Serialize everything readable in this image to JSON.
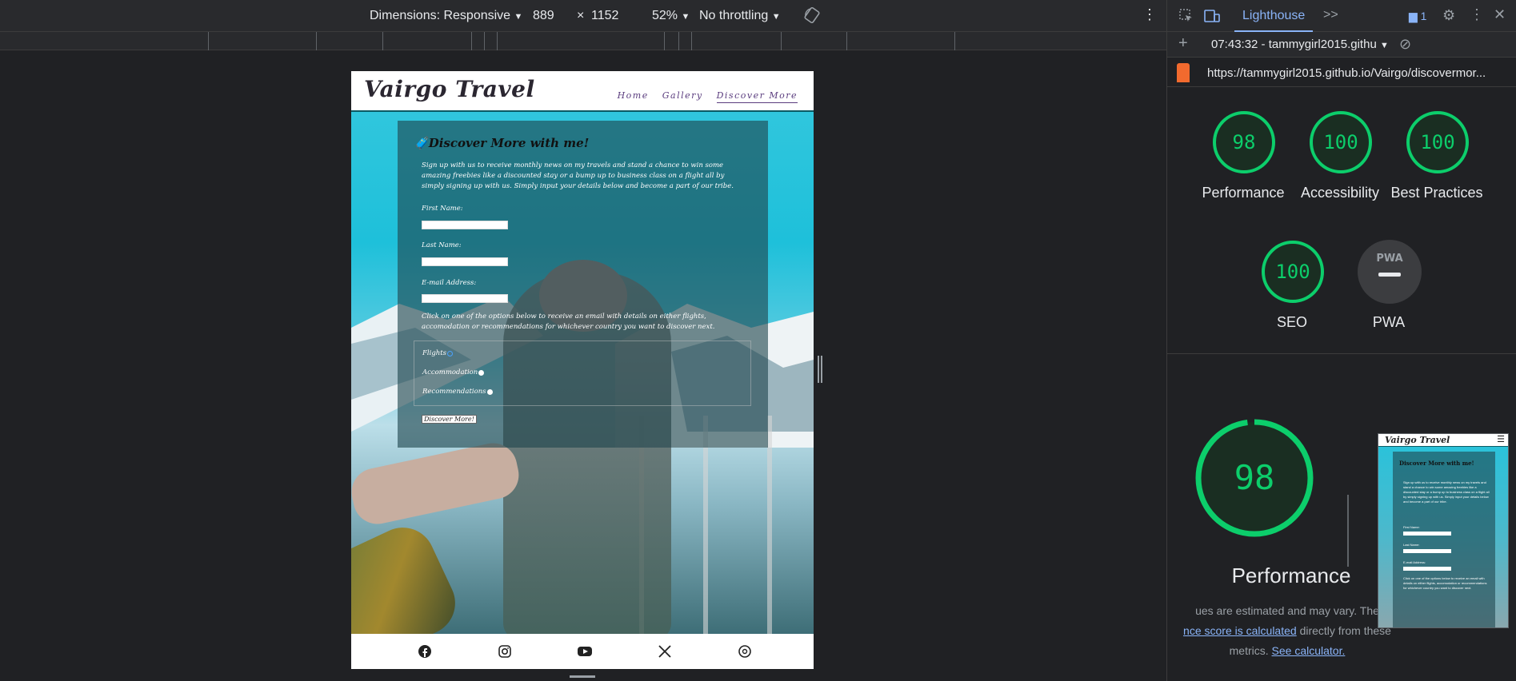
{
  "toolbar": {
    "dimensions_label": "Dimensions: Responsive",
    "width": "889",
    "times": "×",
    "height": "1152",
    "zoom": "52%",
    "throttling": "No throttling"
  },
  "panel": {
    "tab_label": "Lighthouse",
    "more_tabs": ">>",
    "issues_count": "1",
    "report_label": "07:43:32 - tammygirl2015.githu",
    "url": "https://tammygirl2015.github.io/Vairgo/discovermor...",
    "scores": [
      {
        "label": "Performance",
        "value": "98",
        "color": "#0cce6b"
      },
      {
        "label": "Accessibility",
        "value": "100",
        "color": "#0cce6b"
      },
      {
        "label": "Best Practices",
        "value": "100",
        "color": "#0cce6b"
      },
      {
        "label": "SEO",
        "value": "100",
        "color": "#0cce6b"
      },
      {
        "label": "PWA",
        "value": "PWA",
        "color": "#9aa0a6"
      }
    ],
    "big_score": "98",
    "big_label": "Performance",
    "note_line1": "ues are estimated and may vary. The",
    "note_link1": "nce score is calculated",
    "note_line2": " directly from these",
    "note_line3": "metrics.",
    "note_link2": "See calculator."
  },
  "site": {
    "logo": "Vairgo Travel",
    "nav": [
      "Home",
      "Gallery",
      "Discover More"
    ],
    "form_title": "Discover More with me!",
    "intro": "Sign up with us to receive monthly news on my travels and stand a chance to win some amazing freebies like a discounted stay or a bump up to business class on a flight all by simply signing up with us. Simply input your details below and become a part of our tribe.",
    "first_name": "First Name:",
    "last_name": "Last Name:",
    "email": "E-mail Address:",
    "options_text": "Click on one of the options below to receive an email with details on either flights, accomodation or recommendations for whichever country you want to discover next.",
    "radios": [
      "Flights",
      "Accommodation",
      "Recommendations"
    ],
    "submit": "Discover More!"
  },
  "thumb": {
    "logo": "Vairgo Travel",
    "title": "Discover More with me!",
    "intro": "Sign up with us to receive monthly news on my travels and stand a chance to win some amazing freebies like a discounted stay or a bump up to business class on a flight all by simply signing up with us. Simply input your details below and become a part of our tribe.",
    "first_name": "First Name:",
    "last_name": "Last Name:",
    "email": "E-mail Address:",
    "options_text": "Click on one of the options below to receive an email with details on either flights, accomodation or recommendations for whichever country you want to discover next."
  }
}
